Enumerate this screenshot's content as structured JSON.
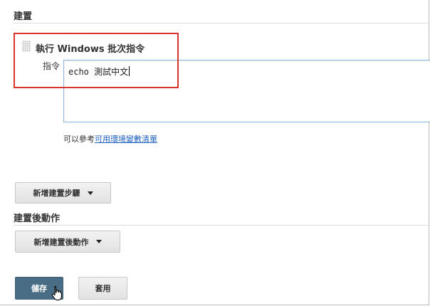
{
  "build": {
    "section_title": "建置",
    "step_title": "執行 Windows 批次指令",
    "command_label": "指令",
    "command_value": "echo 測試中文",
    "help_prefix": "可以參考",
    "help_link": "可用環境變數清單",
    "add_step_label": "新增建置步驟"
  },
  "post_build": {
    "section_title": "建置後動作",
    "add_action_label": "新增建置後動作"
  },
  "actions": {
    "save_label": "儲存",
    "apply_label": "套用"
  },
  "colors": {
    "highlight": "#d9342b",
    "primary_button": "#4a6d86",
    "link": "#1f5fbd"
  },
  "icons": [
    "drag-handle-icon",
    "chevron-down-icon",
    "hand-pointer-icon"
  ]
}
